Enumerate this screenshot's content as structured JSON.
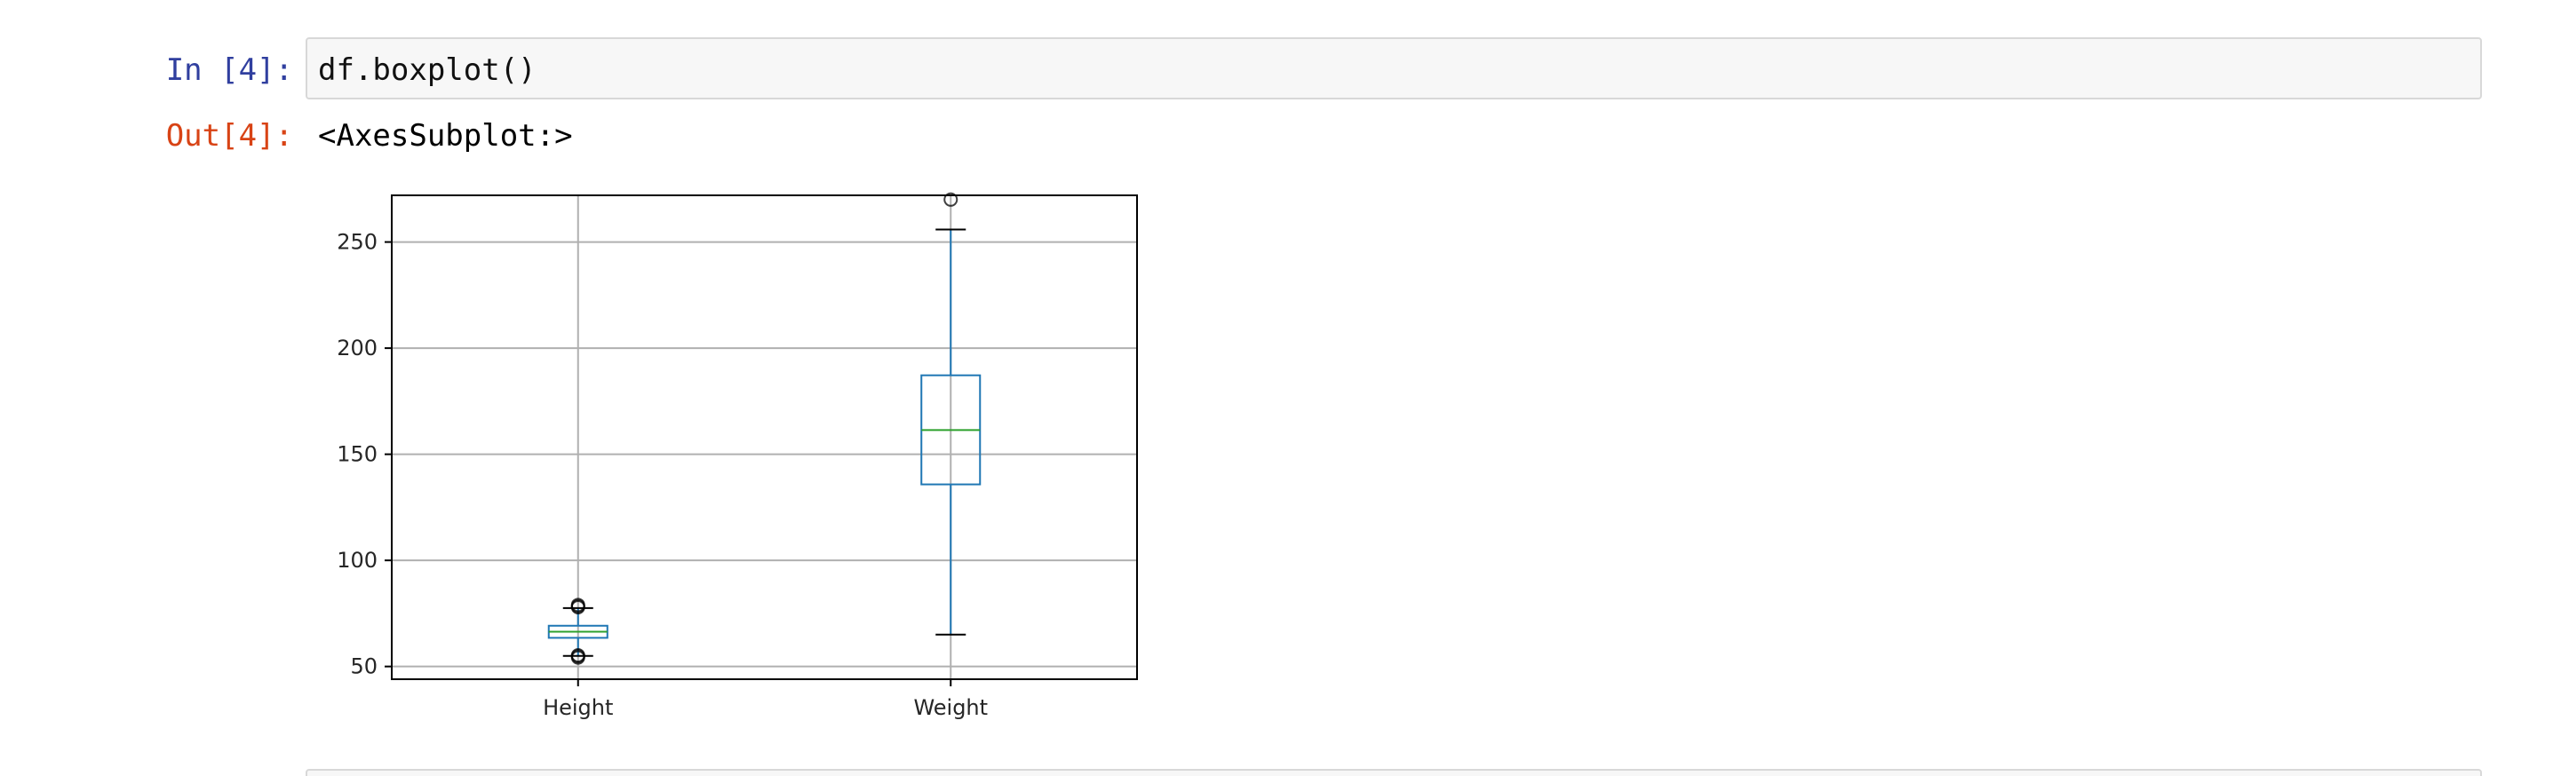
{
  "input_cell": {
    "prompt": "In [4]:",
    "code": "df.boxplot()"
  },
  "output_cell": {
    "prompt": "Out[4]:",
    "text": "<AxesSubplot:>"
  },
  "colors": {
    "in_prompt": "#303f9f",
    "out_prompt": "#d84315",
    "box": "#1f77b4",
    "median": "#2ca02c",
    "whisker": "#1f77b4",
    "cap": "#000000",
    "grid": "#b0b0b0"
  },
  "chart_data": {
    "type": "boxplot",
    "title": "",
    "xlabel": "",
    "ylabel": "",
    "categories": [
      "Height",
      "Weight"
    ],
    "ylim": [
      44,
      272
    ],
    "yticks": [
      50,
      100,
      150,
      200,
      250
    ],
    "grid": true,
    "boxes": [
      {
        "name": "Height",
        "whisker_low": 55,
        "q1": 63.5,
        "median": 66.4,
        "q3": 69.2,
        "whisker_high": 77.5,
        "outliers": [
          54.2,
          54.8,
          55.3,
          77.9,
          78.4,
          79.0
        ]
      },
      {
        "name": "Weight",
        "whisker_low": 65,
        "q1": 135.8,
        "median": 161.4,
        "q3": 187.2,
        "whisker_high": 255.9,
        "outliers": [
          270
        ]
      }
    ]
  }
}
